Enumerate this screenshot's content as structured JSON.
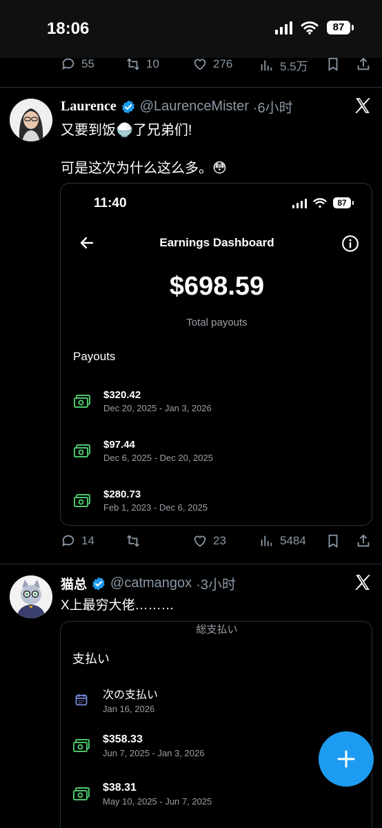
{
  "status_bar": {
    "time": "18:06",
    "battery": "87"
  },
  "prev_actions": {
    "replies": "55",
    "retweets": "10",
    "likes": "276",
    "views": "5.5万"
  },
  "tweet1": {
    "name": "Laurence",
    "handle": "@LaurenceMister",
    "time": "·6小时",
    "text_line1": "又要到饭🍚了兄弟们!",
    "text_line2": "可是这次为什么这么多。😳",
    "card": {
      "time": "11:40",
      "battery": "87",
      "title": "Earnings Dashboard",
      "amount": "$698.59",
      "total_label": "Total payouts",
      "section": "Payouts",
      "payouts": [
        {
          "amount": "$320.42",
          "range": "Dec 20, 2025 - Jan 3, 2026"
        },
        {
          "amount": "$97.44",
          "range": "Dec 6, 2025 - Dec 20, 2025"
        },
        {
          "amount": "$280.73",
          "range": "Feb 1, 2023 - Dec 6, 2025"
        }
      ]
    },
    "actions": {
      "replies": "14",
      "retweets": "",
      "likes": "23",
      "views": "5484"
    }
  },
  "tweet2": {
    "name": "猫总",
    "handle": "@catmangox",
    "time": "·3小时",
    "text": "X上最穷大佬………",
    "card": {
      "top_label": "総支払い",
      "section": "支払い",
      "next_label": "次の支払い",
      "next_date": "Jan 16, 2026",
      "payouts": [
        {
          "amount": "$358.33",
          "range": "Jun 7, 2025 - Jan 3, 2026"
        },
        {
          "amount": "$38.31",
          "range": "May 10, 2025 - Jun 7, 2025"
        }
      ]
    }
  },
  "colors": {
    "accent": "#1d9bf0",
    "cash_green": "#4cc56b",
    "muted": "#8b98a5"
  },
  "icons": [
    "reply-icon",
    "retweet-icon",
    "like-icon",
    "views-icon",
    "bookmark-icon",
    "share-icon",
    "verified-icon",
    "x-logo-icon",
    "back-arrow-icon",
    "info-icon",
    "cash-icon",
    "calendar-icon",
    "plus-icon"
  ]
}
